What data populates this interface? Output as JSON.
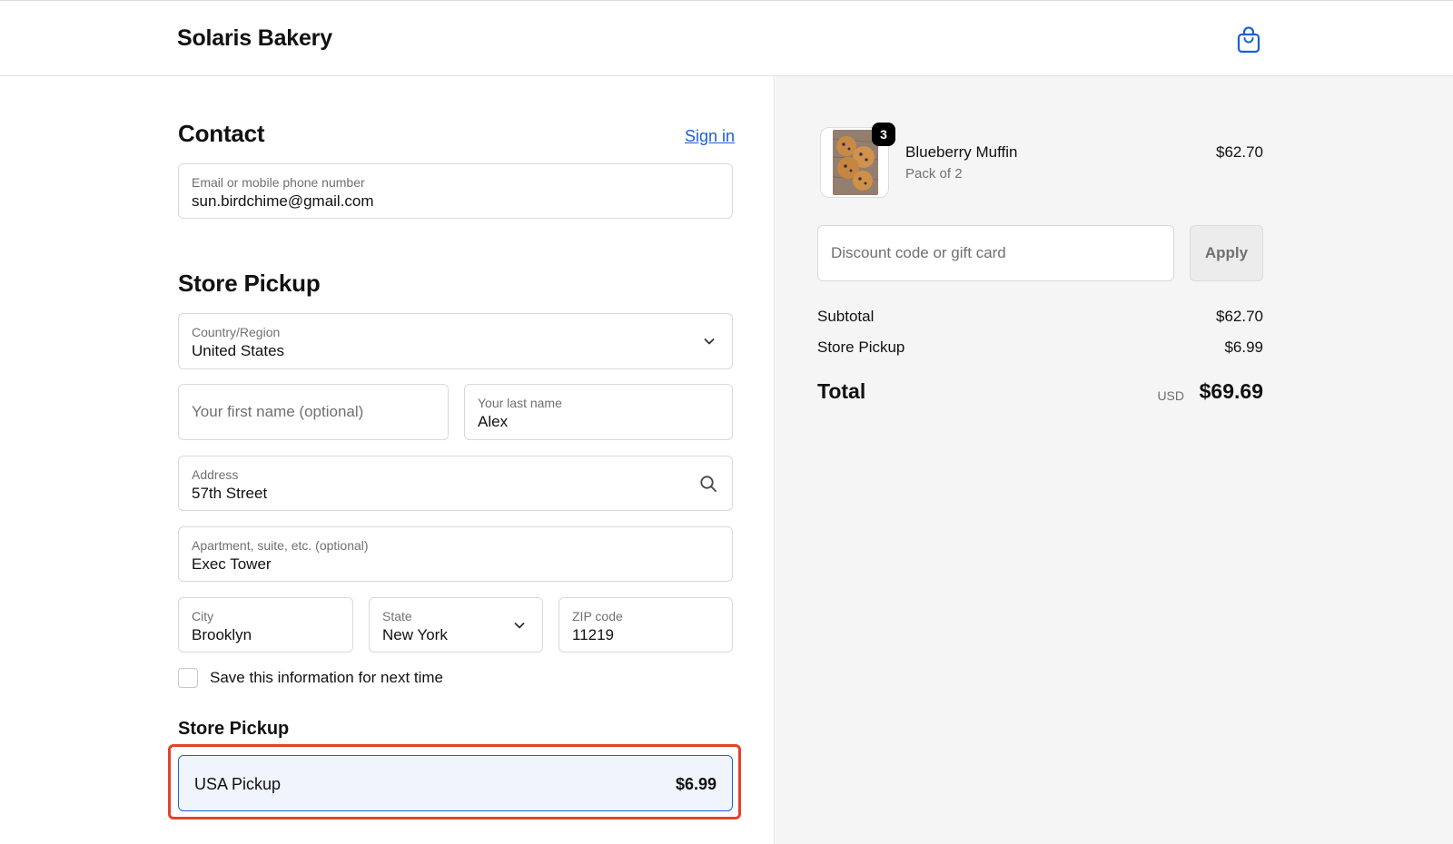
{
  "header": {
    "brand": "Solaris Bakery",
    "cart_icon": "shopping-bag-icon",
    "accent": "#1a5fd6"
  },
  "contact": {
    "title": "Contact",
    "sign_in": "Sign in",
    "email": {
      "label": "Email or mobile phone number",
      "value": "sun.birdchime@gmail.com"
    }
  },
  "pickup": {
    "title": "Store Pickup",
    "country": {
      "label": "Country/Region",
      "value": "United States"
    },
    "first_name": {
      "placeholder": "Your first name (optional)"
    },
    "last_name": {
      "label": "Your last name",
      "value": "Alex"
    },
    "address": {
      "label": "Address",
      "value": "57th Street"
    },
    "apartment": {
      "label": "Apartment, suite, etc. (optional)",
      "value": "Exec Tower"
    },
    "city": {
      "label": "City",
      "value": "Brooklyn"
    },
    "state": {
      "label": "State",
      "value": "New York"
    },
    "zip": {
      "label": "ZIP code",
      "value": "11219"
    },
    "save_info": {
      "label": "Save this information for next time",
      "checked": false
    }
  },
  "pickup_method": {
    "title": "Store Pickup",
    "option": {
      "name": "USA Pickup",
      "price": "$6.99",
      "selected": true
    },
    "highlight_color": "#e5412a"
  },
  "summary": {
    "item": {
      "name": "Blueberry Muffin",
      "variant": "Pack of 2",
      "price": "$62.70",
      "quantity": "3"
    },
    "discount": {
      "placeholder": "Discount code or gift card",
      "apply": "Apply"
    },
    "subtotal": {
      "label": "Subtotal",
      "value": "$62.70"
    },
    "shipping": {
      "label": "Store Pickup",
      "value": "$6.99"
    },
    "total": {
      "label": "Total",
      "currency": "USD",
      "value": "$69.69"
    }
  }
}
